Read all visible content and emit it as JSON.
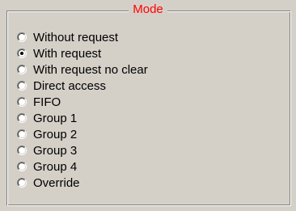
{
  "group": {
    "title": "Mode",
    "title_color": "#ff0000",
    "selected": "With request",
    "options": [
      {
        "label": "Without request",
        "checked": false
      },
      {
        "label": "With request",
        "checked": true
      },
      {
        "label": "With request no clear",
        "checked": false
      },
      {
        "label": "Direct access",
        "checked": false
      },
      {
        "label": "FIFO",
        "checked": false
      },
      {
        "label": "Group 1",
        "checked": false
      },
      {
        "label": "Group 2",
        "checked": false
      },
      {
        "label": "Group 3",
        "checked": false
      },
      {
        "label": "Group 4",
        "checked": false
      },
      {
        "label": "Override",
        "checked": false
      }
    ]
  }
}
